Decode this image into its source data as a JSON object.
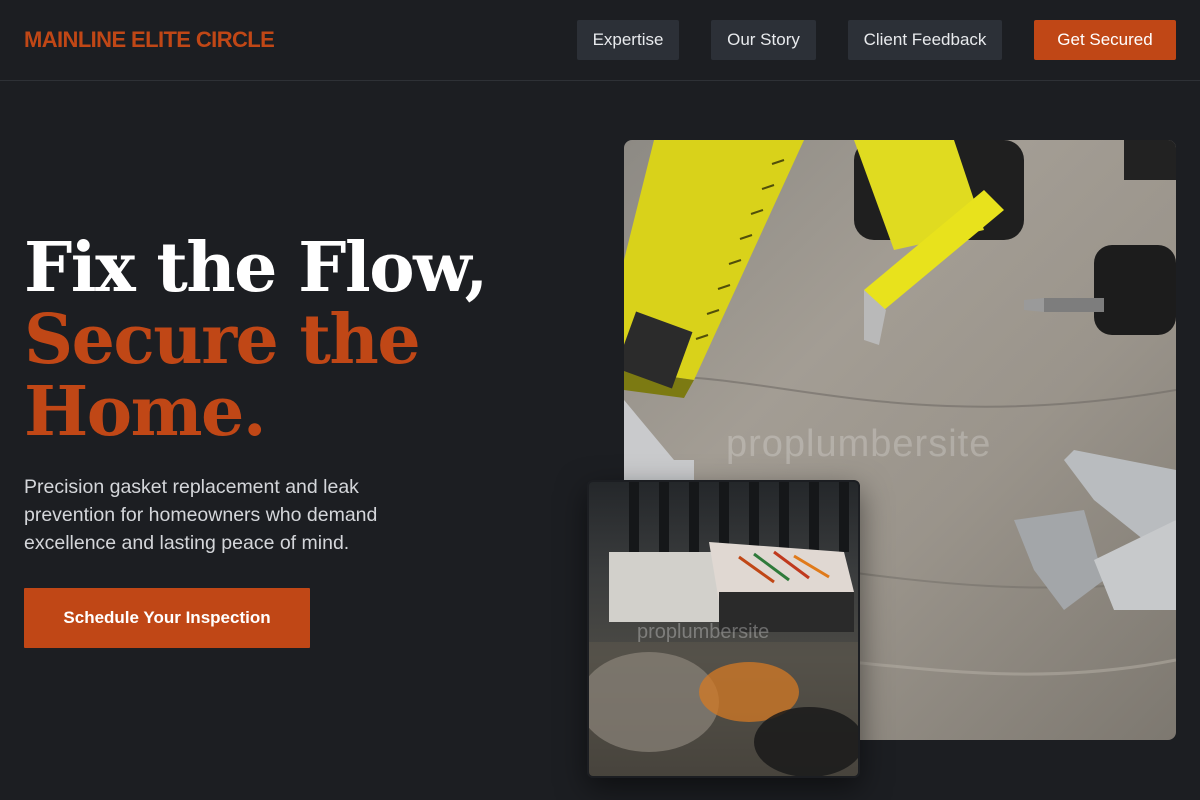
{
  "header": {
    "brand": "MAINLINE ELITE CIRCLE",
    "nav": {
      "expertise": "Expertise",
      "story": "Our Story",
      "feedback": "Client Feedback",
      "cta": "Get Secured"
    }
  },
  "hero": {
    "title_line1": "Fix the Flow,",
    "title_accent_line2": "Secure the",
    "title_accent_line3": "Home.",
    "subtitle": "Precision gasket replacement and leak prevention for homeowners who demand excellence and lasting peace of mind.",
    "cta": "Schedule Your Inspection"
  },
  "images": {
    "main_watermark": "proplumbersite",
    "small_watermark": "proplumbersite"
  },
  "colors": {
    "background": "#1c1e22",
    "accent": "#c04716",
    "nav_button": "#2c3037"
  }
}
